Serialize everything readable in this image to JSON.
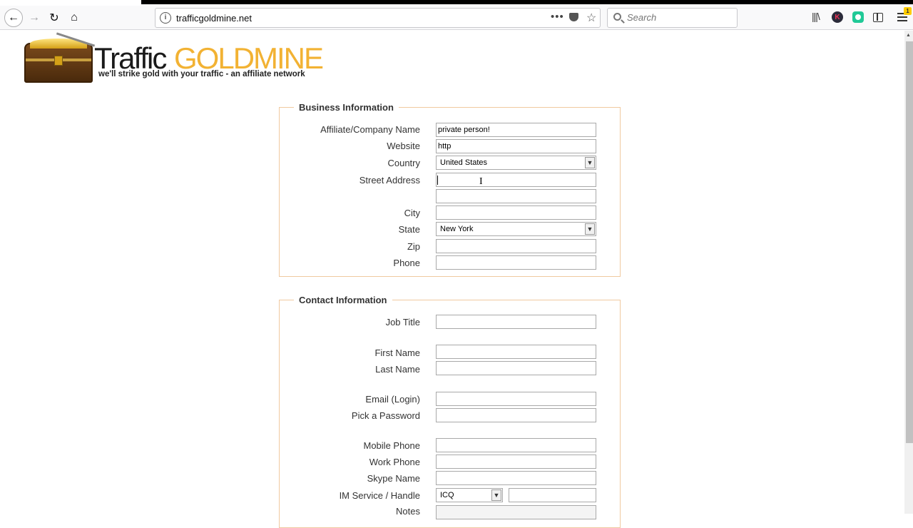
{
  "browser": {
    "url": "trafficgoldmine.net",
    "search_placeholder": "Search",
    "notification_count": "1"
  },
  "logo": {
    "word1": "Traffic",
    "word2": "GOLDMINE",
    "tagline": "we'll strike gold with your traffic - an affiliate network"
  },
  "business": {
    "legend": "Business Information",
    "company_label": "Affiliate/Company Name",
    "company_value": "private person!",
    "website_label": "Website",
    "website_value": "http",
    "country_label": "Country",
    "country_value": "United States",
    "street_label": "Street Address",
    "street_value": "",
    "city_label": "City",
    "state_label": "State",
    "state_value": "New York",
    "zip_label": "Zip",
    "phone_label": "Phone"
  },
  "contact": {
    "legend": "Contact Information",
    "job_title_label": "Job Title",
    "first_name_label": "First Name",
    "last_name_label": "Last Name",
    "email_label": "Email (Login)",
    "password_label": "Pick a Password",
    "mobile_label": "Mobile Phone",
    "work_phone_label": "Work Phone",
    "skype_label": "Skype Name",
    "im_label": "IM Service / Handle",
    "im_service_value": "ICQ",
    "notes_label": "Notes"
  }
}
